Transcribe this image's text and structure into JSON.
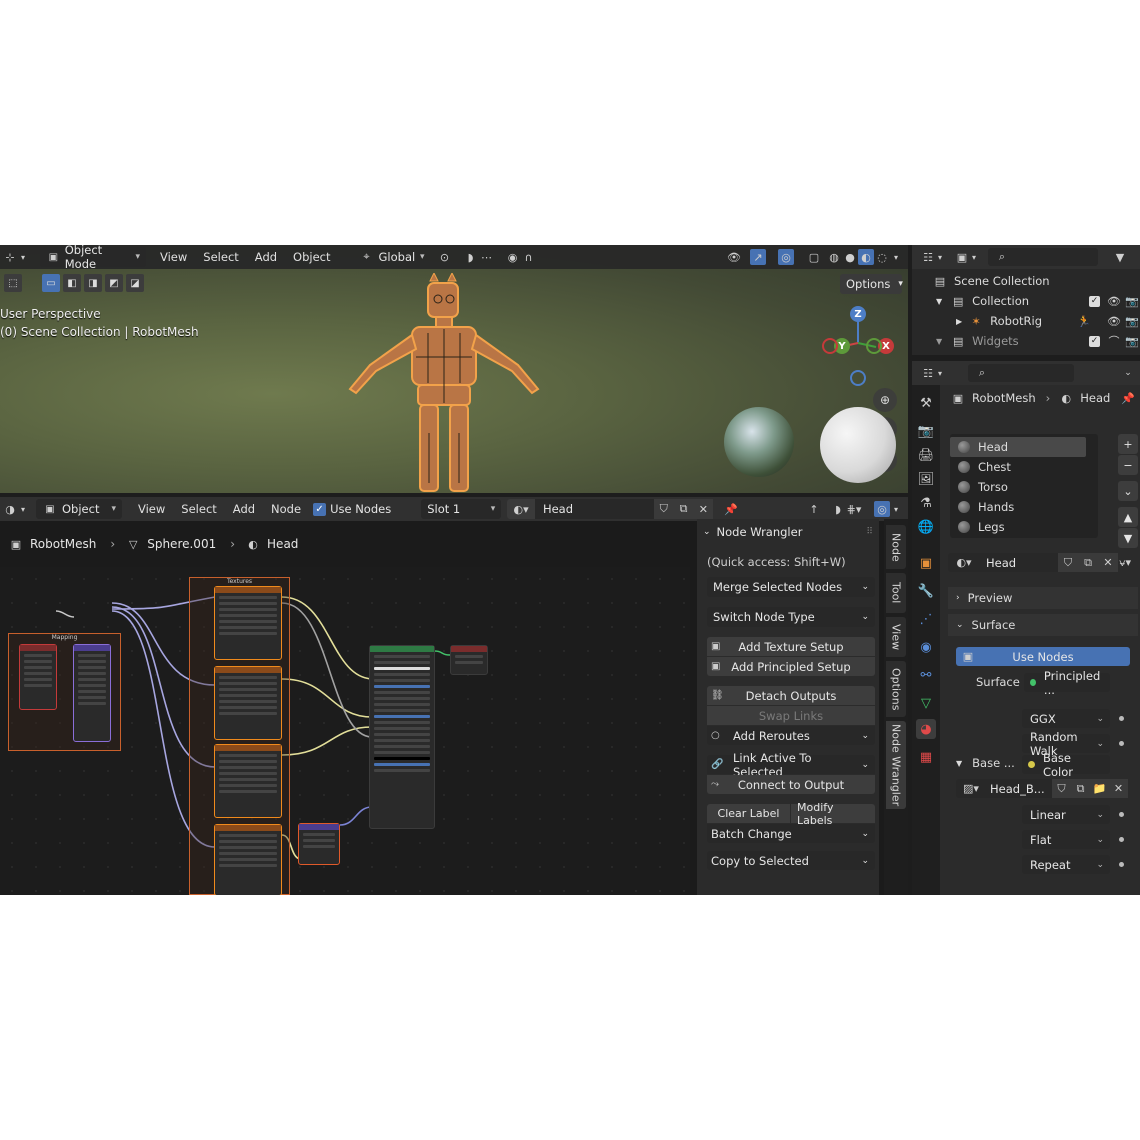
{
  "viewport": {
    "mode": "Object Mode",
    "menus": [
      "View",
      "Select",
      "Add",
      "Object"
    ],
    "transform_orientation": "Global",
    "options": "Options",
    "info_line1": "User Perspective",
    "info_line2": "(0) Scene Collection | RobotMesh",
    "gizmo": {
      "z": "Z",
      "y": "Y",
      "x": "X"
    }
  },
  "node_editor": {
    "mode": "Object",
    "menus": [
      "View",
      "Select",
      "Add",
      "Node"
    ],
    "use_nodes_label": "Use Nodes",
    "slot": "Slot 1",
    "material": "Head",
    "breadcrumb": [
      "RobotMesh",
      "Sphere.001",
      "Head"
    ],
    "frames": {
      "mapping": "Mapping",
      "textures": "Textures"
    }
  },
  "node_wrangler": {
    "title": "Node Wrangler",
    "quick_access": "(Quick access: Shift+W)",
    "merge": "Merge Selected Nodes",
    "switch": "Switch Node Type",
    "add_texture_setup": "Add Texture Setup",
    "add_principled_setup": "Add Principled Setup",
    "detach_outputs": "Detach Outputs",
    "swap_links": "Swap Links",
    "add_reroutes": "Add Reroutes",
    "link_active": "Link Active To Selected",
    "connect_output": "Connect to Output",
    "clear_label": "Clear Label",
    "modify_labels": "Modify Labels",
    "batch_change": "Batch Change",
    "copy_selected": "Copy to Selected"
  },
  "side_tabs": [
    "Node",
    "Tool",
    "View",
    "Options",
    "Node Wrangler"
  ],
  "outliner": {
    "scene_collection": "Scene Collection",
    "collection": "Collection",
    "robotrig": "RobotRig",
    "widgets": "Widgets"
  },
  "properties": {
    "breadcrumb_object": "RobotMesh",
    "breadcrumb_material": "Head",
    "slots": [
      "Head",
      "Chest",
      "Torso",
      "Hands",
      "Legs"
    ],
    "material_name": "Head",
    "preview": "Preview",
    "surface_section": "Surface",
    "use_nodes": "Use Nodes",
    "surface_label": "Surface",
    "surface_value": "Principled ...",
    "distribution": "GGX",
    "subsurface": "Random Walk",
    "base_label": "Base ...",
    "base_value": "Base Color",
    "image_name": "Head_B...",
    "interpolation": "Linear",
    "projection": "Flat",
    "extension": "Repeat"
  },
  "colors": {
    "accent": "#4772b3",
    "frame": "#c8602c",
    "node_selected": "#f08a1c"
  }
}
